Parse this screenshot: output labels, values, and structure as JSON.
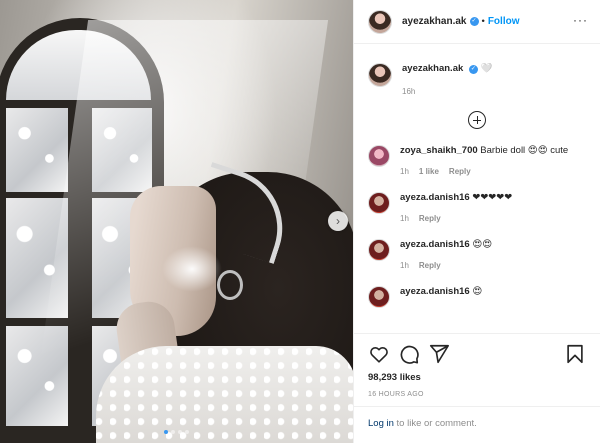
{
  "post": {
    "author": "ayezakhan.ak",
    "follow_label": "Follow",
    "separator": "•",
    "caption_text": "🤍",
    "caption_time": "16h",
    "likes": "98,293 likes",
    "time_ago": "16 HOURS AGO",
    "carousel": {
      "count": 4,
      "active_index": 0
    }
  },
  "comments": [
    {
      "user": "zoya_shaikh_700",
      "text": "Barbie doll 😍😍 cute",
      "time": "1h",
      "likes": "1 like",
      "reply": "Reply"
    },
    {
      "user": "ayeza.danish16",
      "text": "❤❤❤❤❤",
      "time": "1h",
      "likes": "",
      "reply": "Reply"
    },
    {
      "user": "ayeza.danish16",
      "text": "😍😍",
      "time": "1h",
      "likes": "",
      "reply": "Reply"
    },
    {
      "user": "ayeza.danish16",
      "text": "😍",
      "time": "",
      "likes": "",
      "reply": ""
    }
  ],
  "footer": {
    "login_link": "Log in",
    "login_rest": " to like or comment."
  },
  "icons": {
    "like": "heart-icon",
    "comment": "comment-icon",
    "share": "share-icon",
    "save": "bookmark-icon",
    "more": "more-options-icon",
    "next": "chevron-right-icon",
    "load_more": "plus-circle-icon"
  },
  "colors": {
    "accent": "#0095f6",
    "verified": "#3897f0",
    "muted": "#8e8e8e",
    "text": "#262626"
  }
}
